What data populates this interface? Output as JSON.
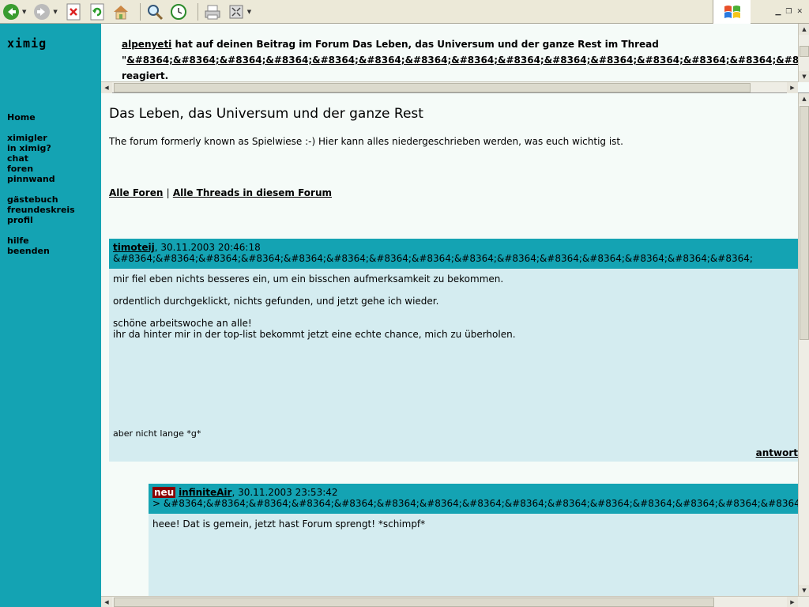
{
  "toolbar": {
    "buttons": [
      "back-icon",
      "forward-icon",
      "stop-icon",
      "refresh-icon",
      "home-icon",
      "search-icon",
      "history-icon",
      "print-icon",
      "fullscreen-icon"
    ]
  },
  "sidebar": {
    "brand": "ximig",
    "home": "Home",
    "group1": [
      "ximigler",
      "in ximig?",
      "chat",
      "foren",
      "pinnwand"
    ],
    "group2": [
      "gästebuch",
      "freundeskreis",
      "profil"
    ],
    "group3": [
      "hilfe",
      "beenden"
    ],
    "bg_color": "#14a3b3"
  },
  "notification": {
    "user": "alpenyeti",
    "text": " hat auf deinen Beitrag im Forum Das Leben, das Universum und der ganze Rest im Thread",
    "thread_link": "&#8364;&#8364;&#8364;&#8364;&#8364;&#8364;&#8364;&#8364;&#8364;&#8364;&#8364;&#8364;&#8364;&#8364;&#8364;&#8364;",
    "quote_open": "\"",
    "reacted": "reagiert."
  },
  "forum": {
    "title": "Das Leben, das Universum und der ganze Rest",
    "description": "The forum formerly known as Spielwiese :-) Hier kann alles niedergeschrieben werden, was euch wichtig ist.",
    "link_all_forums": "Alle Foren",
    "separator": "|",
    "link_all_threads": "Alle Threads in diesem Forum"
  },
  "posts": [
    {
      "author": "timoteij",
      "date": ", 30.11.2003 20:46:18",
      "subject": "&#8364;&#8364;&#8364;&#8364;&#8364;&#8364;&#8364;&#8364;&#8364;&#8364;&#8364;&#8364;&#8364;&#8364;&#8364;",
      "para1": "mir fiel eben nichts besseres ein, um ein bisschen aufmerksamkeit zu bekommen.",
      "para2": "ordentlich durchgeklickt, nichts gefunden, und jetzt gehe ich wieder.",
      "para3a": "schöne arbeitswoche an alle!",
      "para3b": "ihr da hinter mir in der top-list bekommt jetzt eine echte chance, mich zu überholen.",
      "footer": "aber nicht lange *g*",
      "reply": "antwort"
    },
    {
      "badge": "neu",
      "author": "infiniteAir",
      "date": ", 30.11.2003 23:53:42",
      "subject": "> &#8364;&#8364;&#8364;&#8364;&#8364;&#8364;&#8364;&#8364;&#8364;&#8364;&#8364;&#8364;&#8364;&#8364;&#8364;",
      "para1": "heee! Dat is gemein, jetzt hast Forum sprengt! *schimpf*"
    }
  ]
}
